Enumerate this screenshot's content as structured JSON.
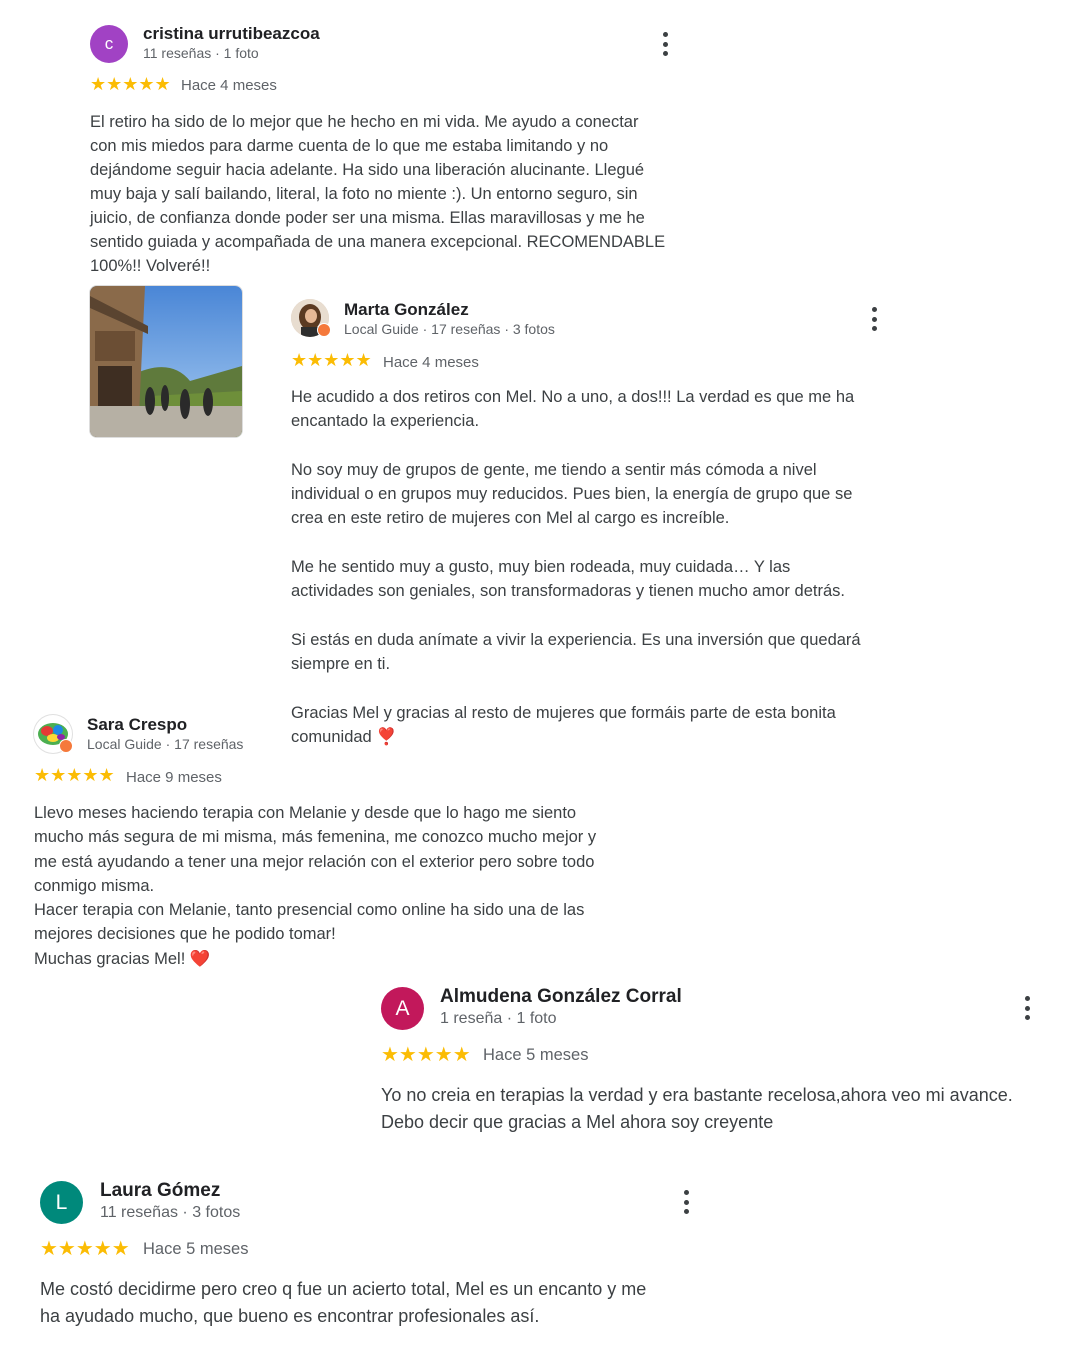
{
  "reviews": [
    {
      "author": "cristina urrutibeazcoa",
      "initial": "c",
      "meta": "11 reseñas · 1 foto",
      "stars": "★★★★★",
      "date": "Hace 4 meses",
      "text": "El retiro ha sido de lo mejor que he hecho en mi vida. Me ayudo a conectar\ncon mis miedos para darme cuenta de lo que me estaba limitando y no\ndejándome seguir hacia adelante. Ha sido una liberación alucinante. Llegué\nmuy baja y salí bailando, literal, la foto no miente :). Un entorno seguro, sin\njuicio, de confianza donde poder ser una misma. Ellas maravillosas y me he\nsentido guiada y acompañada de una manera excepcional. RECOMENDABLE\n100%!! Volveré!!",
      "avatar_color": "#a142c4"
    },
    {
      "author": "Marta González",
      "meta": "Local Guide · 17 reseñas · 3 fotos",
      "stars": "★★★★★",
      "date": "Hace 4 meses",
      "text": "He acudido a dos retiros con Mel. No a uno, a dos!!! La verdad es que me ha\nencantado la experiencia.\n\nNo soy muy de grupos de gente, me tiendo a sentir más cómoda a nivel\nindividual o en grupos muy reducidos. Pues bien, la energía de grupo que se\ncrea en este retiro de mujeres con Mel al cargo es increíble.\n\nMe he sentido muy a gusto, muy bien rodeada, muy cuidada… Y las\nactividades son geniales, son transformadoras y tienen mucho amor detrás.\n\nSi estás en duda anímate a vivir la experiencia. Es una inversión que quedará\nsiempre en ti.\n\nGracias Mel y gracias al resto de mujeres que formáis parte de esta bonita\ncomunidad ❣️"
    },
    {
      "author": "Sara Crespo",
      "meta": "Local Guide · 17 reseñas",
      "stars": "★★★★★",
      "date": "Hace 9 meses",
      "text": "Llevo meses haciendo terapia con Melanie y desde que lo hago me siento\nmucho más segura de mi misma, más femenina, me conozco mucho mejor y\nme está ayudando a tener una mejor relación con el exterior pero sobre todo\nconmigo misma.\nHacer terapia con Melanie, tanto presencial como online ha sido una de las\nmejores decisiones que he podido tomar!\nMuchas gracias Mel! ❤️"
    },
    {
      "author": "Almudena González Corral",
      "initial": "A",
      "meta": "1 reseña · 1 foto",
      "stars": "★★★★★",
      "date": "Hace 5 meses",
      "text": "Yo no creia en terapias la verdad y era bastante recelosa,ahora veo mi avance.\nDebo decir que gracias a Mel ahora soy creyente",
      "avatar_color": "#c2185b"
    },
    {
      "author": "Laura Gómez",
      "initial": "L",
      "meta": "11 reseñas · 3 fotos",
      "stars": "★★★★★",
      "date": "Hace 5 meses",
      "text": "Me costó decidirme pero creo q fue un acierto total, Mel es un encanto y me\nha ayudado mucho, que bueno es encontrar profesionales así.",
      "avatar_color": "#00897b"
    }
  ],
  "colors": {
    "star": "#fbbc04",
    "meta_text": "#5f6368",
    "body_text": "#3c4043",
    "local_guide_badge": "#f5793b"
  },
  "icons": [
    "more-vert-icon",
    "star-icon",
    "local-guide-badge-icon"
  ]
}
